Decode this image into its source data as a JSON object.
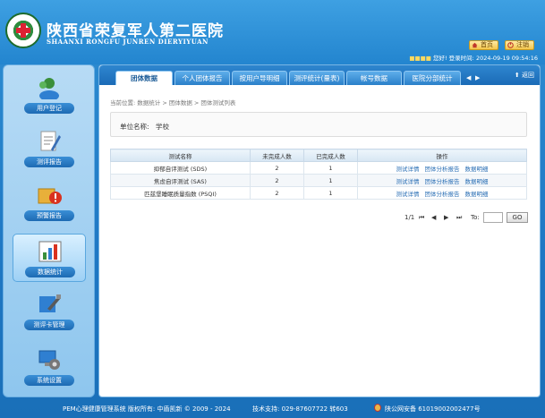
{
  "header": {
    "title_cn": "陕西省荣复军人第二医院",
    "title_en": "SHAANXI RONGFU JUNREN DIERYIYUAN",
    "home_label": "首页",
    "logout_label": "注销",
    "greeting": "您好!",
    "login_time_label": "登录时间:",
    "login_time": "2024-09-19 09:54:16"
  },
  "sidebar": {
    "items": [
      {
        "label": "用户登记",
        "icon": "user-icon"
      },
      {
        "label": "测评报告",
        "icon": "report-icon"
      },
      {
        "label": "预警报告",
        "icon": "warning-icon"
      },
      {
        "label": "数据统计",
        "icon": "chart-icon"
      },
      {
        "label": "测评卡管理",
        "icon": "card-icon"
      },
      {
        "label": "系统设置",
        "icon": "gear-icon"
      }
    ],
    "active_index": 3
  },
  "tabs": {
    "items": [
      "团体数据",
      "个人团体报告",
      "按用户导明细",
      "测评统计(量表)",
      "帐号数据",
      "医院分部统计"
    ],
    "active_index": 0,
    "back_label": "返回"
  },
  "breadcrumb": "当前位置: 数据统计 > 团体数据 > 团体测试列表",
  "unit": {
    "label": "单位名称:",
    "value": "学校"
  },
  "table": {
    "headers": [
      "测试名称",
      "未完成人数",
      "已完成人数",
      "操作"
    ],
    "rows": [
      {
        "name": "抑郁自评测试 (SDS)",
        "incomplete": "2",
        "complete": "1"
      },
      {
        "name": "焦虑自评测试 (SAS)",
        "incomplete": "2",
        "complete": "1"
      },
      {
        "name": "匹兹堡睡眠质量指数 (PSQI)",
        "incomplete": "2",
        "complete": "1"
      }
    ],
    "actions": [
      "测试详情",
      "团体分析报告",
      "数据明细"
    ]
  },
  "pager": {
    "page_info": "1/1",
    "to_label": "To:",
    "go_label": "GO"
  },
  "footer": {
    "copyright": "PEM心理健康管理系统 版权所有: 中盾凯新 © 2009 - 2024",
    "support": "技术支持: 029-87607722 转603",
    "police": "陕公网安备 61019002002477号"
  }
}
